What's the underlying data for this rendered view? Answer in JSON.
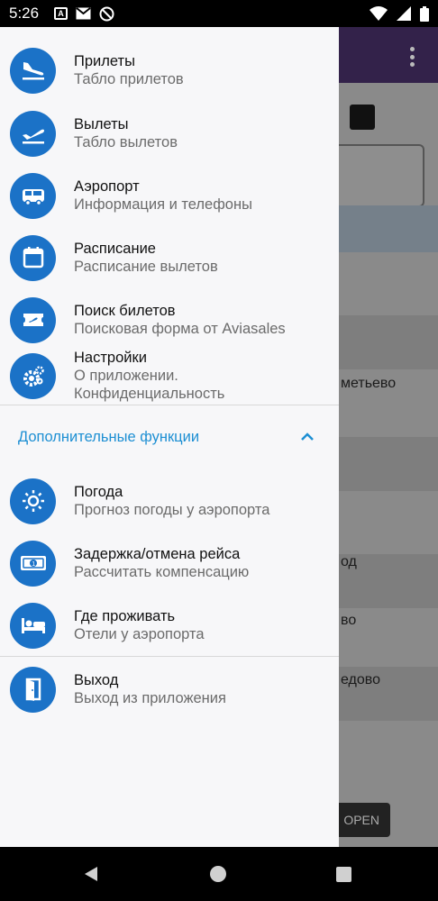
{
  "status_bar": {
    "time": "5:26",
    "left_icons": [
      "a-icon",
      "gmail-icon",
      "vpn-icon"
    ],
    "right_icons": [
      "wifi-icon",
      "signal-icon",
      "battery-icon"
    ]
  },
  "background_app": {
    "visible_texts": [
      "метьево",
      "од",
      "во",
      "едово",
      "OPEN"
    ]
  },
  "drawer": {
    "items": [
      {
        "icon": "plane-landing-icon",
        "title": "Прилеты",
        "subtitle": "Табло прилетов"
      },
      {
        "icon": "plane-takeoff-icon",
        "title": "Вылеты",
        "subtitle": "Табло вылетов"
      },
      {
        "icon": "bus-icon",
        "title": "Аэропорт",
        "subtitle": "Информация и телефоны"
      },
      {
        "icon": "calendar-icon",
        "title": "Расписание",
        "subtitle": "Расписание вылетов"
      },
      {
        "icon": "ticket-icon",
        "title": "Поиск билетов",
        "subtitle": "Поисковая форма от Aviasales"
      },
      {
        "icon": "settings-icon",
        "title": "Настройки",
        "subtitle_line1": "О приложении.",
        "subtitle_line2": "Конфиденциальность"
      }
    ],
    "section": {
      "label": "Дополнительные функции",
      "icon": "chevron-up-icon"
    },
    "extra_items": [
      {
        "icon": "sun-icon",
        "title": "Погода",
        "subtitle": "Прогноз погоды у аэропорта"
      },
      {
        "icon": "money-icon",
        "title": "Задержка/отмена рейса",
        "subtitle": "Рассчитать компенсацию"
      },
      {
        "icon": "bed-icon",
        "title": "Где проживать",
        "subtitle": "Отели у аэропорта"
      }
    ],
    "exit_item": {
      "icon": "exit-door-icon",
      "title": "Выход",
      "subtitle": "Выход из приложения"
    }
  },
  "colors": {
    "accent": "#1b72c7",
    "section": "#1d8fd3"
  }
}
